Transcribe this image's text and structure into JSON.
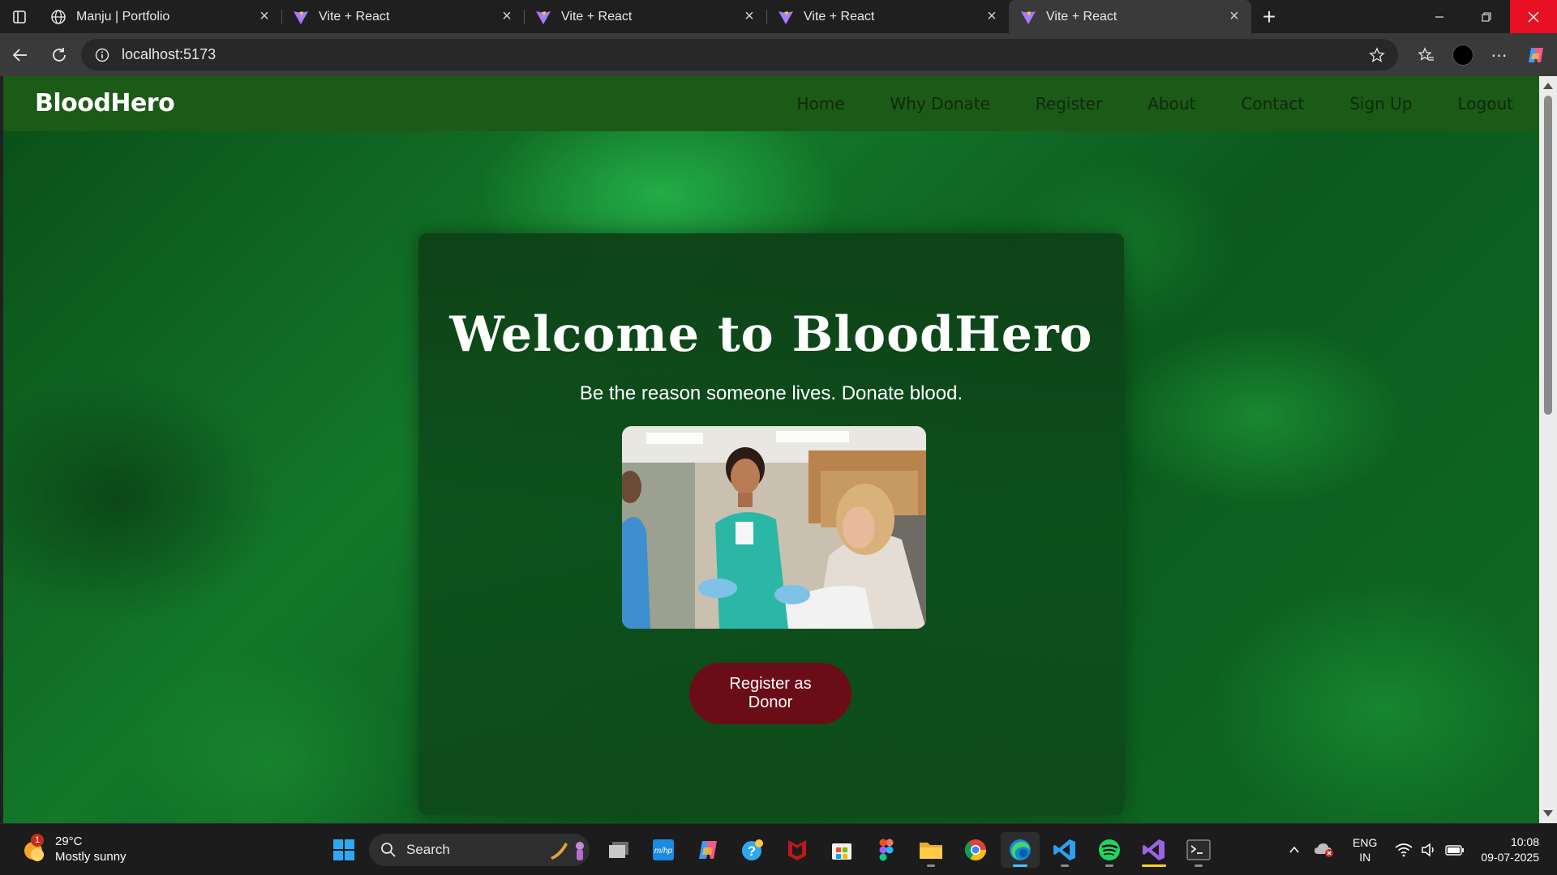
{
  "browser": {
    "tabs": [
      {
        "title": "Manju | Portfolio",
        "icon": "globe-icon",
        "active": false
      },
      {
        "title": "Vite + React",
        "icon": "vite-icon",
        "active": false
      },
      {
        "title": "Vite + React",
        "icon": "vite-icon",
        "active": false
      },
      {
        "title": "Vite + React",
        "icon": "vite-icon",
        "active": false
      },
      {
        "title": "Vite + React",
        "icon": "vite-icon",
        "active": true
      }
    ],
    "url": "localhost:5173"
  },
  "site": {
    "brand": "BloodHero",
    "nav": [
      "Home",
      "Why Donate",
      "Register",
      "About",
      "Contact",
      "Sign Up",
      "Logout"
    ],
    "hero": {
      "title": "Welcome to BloodHero",
      "subtitle": "Be the reason someone lives. Donate blood.",
      "cta_line1": "Register as",
      "cta_line2": "Donor"
    },
    "colors": {
      "navbar": "#1b5a17",
      "cta": "#6b0d17",
      "accent_green": "#13782a"
    }
  },
  "taskbar": {
    "weather": {
      "temp": "29°C",
      "condition": "Mostly sunny",
      "badge": "1"
    },
    "search_placeholder": "Search",
    "apps": [
      "file-explorer-icon",
      "mhp-icon",
      "copilot-icon",
      "get-help-icon",
      "mcafee-icon",
      "microsoft-store-icon",
      "figma-icon",
      "folder-icon",
      "chrome-icon",
      "edge-icon",
      "vscode-icon",
      "spotify-icon",
      "visual-studio-icon",
      "terminal-icon"
    ],
    "lang_line1": "ENG",
    "lang_line2": "IN",
    "time": "10:08",
    "date": "09-07-2025"
  }
}
